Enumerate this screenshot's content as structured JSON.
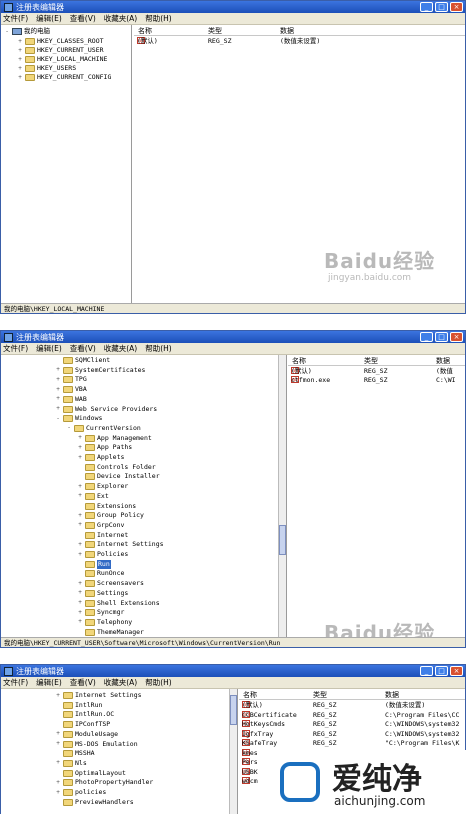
{
  "window1": {
    "title": "注册表编辑器",
    "menu": [
      "文件(F)",
      "编辑(E)",
      "查看(V)",
      "收藏夹(A)",
      "帮助(H)"
    ],
    "tree": [
      {
        "label": "我的电脑",
        "level": 0,
        "toggle": "-",
        "icon": "pc"
      },
      {
        "label": "HKEY_CLASSES_ROOT",
        "level": 1,
        "toggle": "+",
        "icon": "folder"
      },
      {
        "label": "HKEY_CURRENT_USER",
        "level": 1,
        "toggle": "+",
        "icon": "folder"
      },
      {
        "label": "HKEY_LOCAL_MACHINE",
        "level": 1,
        "toggle": "+",
        "icon": "folder"
      },
      {
        "label": "HKEY_USERS",
        "level": 1,
        "toggle": "+",
        "icon": "folder"
      },
      {
        "label": "HKEY_CURRENT_CONFIG",
        "level": 1,
        "toggle": "+",
        "icon": "folder"
      }
    ],
    "columns": [
      "名称",
      "类型",
      "数据"
    ],
    "values": [
      {
        "name": "(默认)",
        "type": "REG_SZ",
        "data": "(数值未设置)"
      }
    ],
    "status": "我的电脑\\HKEY_LOCAL_MACHINE"
  },
  "window2": {
    "title": "注册表编辑器",
    "menu": [
      "文件(F)",
      "编辑(E)",
      "查看(V)",
      "收藏夹(A)",
      "帮助(H)"
    ],
    "tree": [
      {
        "label": "SQMClient",
        "level": 2,
        "toggle": "",
        "icon": "folder"
      },
      {
        "label": "SystemCertificates",
        "level": 2,
        "toggle": "+",
        "icon": "folder"
      },
      {
        "label": "TPG",
        "level": 2,
        "toggle": "+",
        "icon": "folder"
      },
      {
        "label": "VBA",
        "level": 2,
        "toggle": "+",
        "icon": "folder"
      },
      {
        "label": "WAB",
        "level": 2,
        "toggle": "+",
        "icon": "folder"
      },
      {
        "label": "Web Service Providers",
        "level": 2,
        "toggle": "+",
        "icon": "folder"
      },
      {
        "label": "Windows",
        "level": 2,
        "toggle": "-",
        "icon": "folder"
      },
      {
        "label": "CurrentVersion",
        "level": 3,
        "toggle": "-",
        "icon": "folder"
      },
      {
        "label": "App Management",
        "level": 4,
        "toggle": "+",
        "icon": "folder"
      },
      {
        "label": "App Paths",
        "level": 4,
        "toggle": "+",
        "icon": "folder"
      },
      {
        "label": "Applets",
        "level": 4,
        "toggle": "+",
        "icon": "folder"
      },
      {
        "label": "Controls Folder",
        "level": 4,
        "toggle": "",
        "icon": "folder"
      },
      {
        "label": "Device Installer",
        "level": 4,
        "toggle": "",
        "icon": "folder"
      },
      {
        "label": "Explorer",
        "level": 4,
        "toggle": "+",
        "icon": "folder"
      },
      {
        "label": "Ext",
        "level": 4,
        "toggle": "+",
        "icon": "folder"
      },
      {
        "label": "Extensions",
        "level": 4,
        "toggle": "",
        "icon": "folder"
      },
      {
        "label": "Group Policy",
        "level": 4,
        "toggle": "+",
        "icon": "folder"
      },
      {
        "label": "GrpConv",
        "level": 4,
        "toggle": "+",
        "icon": "folder"
      },
      {
        "label": "Internet",
        "level": 4,
        "toggle": "",
        "icon": "folder"
      },
      {
        "label": "Internet Settings",
        "level": 4,
        "toggle": "+",
        "icon": "folder"
      },
      {
        "label": "Policies",
        "level": 4,
        "toggle": "+",
        "icon": "folder"
      },
      {
        "label": "Run",
        "level": 4,
        "toggle": "",
        "icon": "folder",
        "selected": true
      },
      {
        "label": "RunOnce",
        "level": 4,
        "toggle": "",
        "icon": "folder"
      },
      {
        "label": "Screensavers",
        "level": 4,
        "toggle": "+",
        "icon": "folder"
      },
      {
        "label": "Settings",
        "level": 4,
        "toggle": "+",
        "icon": "folder"
      },
      {
        "label": "Shell Extensions",
        "level": 4,
        "toggle": "+",
        "icon": "folder"
      },
      {
        "label": "Syncmgr",
        "level": 4,
        "toggle": "+",
        "icon": "folder"
      },
      {
        "label": "Telephony",
        "level": 4,
        "toggle": "+",
        "icon": "folder"
      },
      {
        "label": "ThemeManager",
        "level": 4,
        "toggle": "",
        "icon": "folder"
      }
    ],
    "columns": [
      "名称",
      "类型",
      "数据"
    ],
    "values": [
      {
        "name": "(默认)",
        "type": "REG_SZ",
        "data": "(数值"
      },
      {
        "name": "ctfmon.exe",
        "type": "REG_SZ",
        "data": "C:\\WI"
      }
    ],
    "status": "我的电脑\\HKEY_CURRENT_USER\\Software\\Microsoft\\Windows\\CurrentVersion\\Run"
  },
  "window3": {
    "title": "注册表编辑器",
    "menu": [
      "文件(F)",
      "编辑(E)",
      "查看(V)",
      "收藏夹(A)",
      "帮助(H)"
    ],
    "tree": [
      {
        "label": "Internet Settings",
        "level": 4,
        "toggle": "+",
        "icon": "folder"
      },
      {
        "label": "IntlRun",
        "level": 4,
        "toggle": "",
        "icon": "folder"
      },
      {
        "label": "IntlRun.OC",
        "level": 4,
        "toggle": "",
        "icon": "folder"
      },
      {
        "label": "IPConfTSP",
        "level": 4,
        "toggle": "",
        "icon": "folder"
      },
      {
        "label": "ModuleUsage",
        "level": 4,
        "toggle": "+",
        "icon": "folder"
      },
      {
        "label": "MS-DOS Emulation",
        "level": 4,
        "toggle": "+",
        "icon": "folder"
      },
      {
        "label": "MSSHA",
        "level": 4,
        "toggle": "",
        "icon": "folder"
      },
      {
        "label": "Nls",
        "level": 4,
        "toggle": "+",
        "icon": "folder"
      },
      {
        "label": "OptimalLayout",
        "level": 4,
        "toggle": "",
        "icon": "folder"
      },
      {
        "label": "PhotoPropertyHandler",
        "level": 4,
        "toggle": "+",
        "icon": "folder"
      },
      {
        "label": "policies",
        "level": 4,
        "toggle": "+",
        "icon": "folder"
      },
      {
        "label": "PreviewHandlers",
        "level": 4,
        "toggle": "",
        "icon": "folder"
      }
    ],
    "columns": [
      "名称",
      "类型",
      "数据"
    ],
    "values": [
      {
        "name": "(默认)",
        "type": "REG_SZ",
        "data": "(数值未设置)"
      },
      {
        "name": "CCBCertificate",
        "type": "REG_SZ",
        "data": "C:\\Program Files\\CC"
      },
      {
        "name": "HotKeysCmds",
        "type": "REG_SZ",
        "data": "C:\\WINDOWS\\system32"
      },
      {
        "name": "IgfxTray",
        "type": "REG_SZ",
        "data": "C:\\WINDOWS\\system32"
      },
      {
        "name": "KSafeTray",
        "type": "REG_SZ",
        "data": "\"C:\\Program Files\\K"
      },
      {
        "name": "kmes",
        "type": "",
        "data": ""
      },
      {
        "name": "Pers",
        "type": "",
        "data": ""
      },
      {
        "name": "USBK",
        "type": "",
        "data": ""
      },
      {
        "name": "wdcm",
        "type": "",
        "data": ""
      }
    ]
  },
  "watermarks": {
    "brand": "Baidu经验",
    "url": "jingyan.baidu.com"
  },
  "site_logo": {
    "text": "爱纯净",
    "url": "aichunjing.com"
  }
}
